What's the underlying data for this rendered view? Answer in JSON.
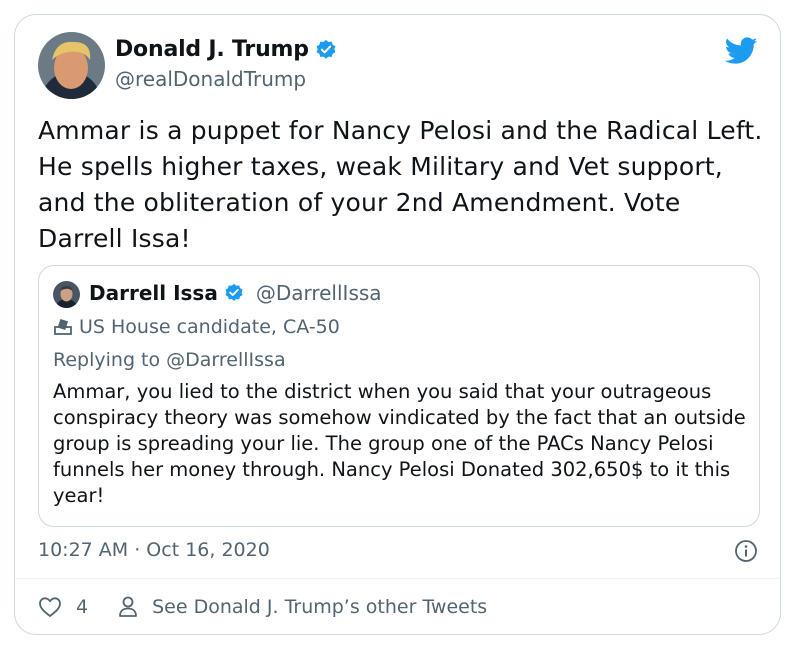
{
  "author": {
    "name": "Donald J. Trump",
    "handle": "@realDonaldTrump",
    "verified": true
  },
  "tweet": {
    "text": "Ammar is a puppet for Nancy Pelosi and the Radical Left. He spells higher taxes, weak Military and Vet support, and the obliteration of your 2nd Amendment. Vote Darrell Issa!",
    "timestamp": "10:27 AM · Oct 16, 2020",
    "likes": "4",
    "see_more": "See Donald J. Trump’s other Tweets"
  },
  "quoted": {
    "name": "Darrell Issa",
    "handle": "@DarrellIssa",
    "label": "US House candidate, CA-50",
    "replying_to": "Replying to @DarrellIssa",
    "text": "Ammar, you lied to the district when you said that your outrageous conspiracy theory was somehow vindicated by the fact that an outside group is spreading your lie. The group  one of the PACs Nancy Pelosi funnels her money through. Nancy Pelosi Donated 302,650$ to it this year!"
  },
  "icons": {
    "brand": "twitter-bird-icon",
    "verified": "verified-badge-icon",
    "label": "ballot-box-icon",
    "info": "info-icon",
    "like": "heart-icon",
    "profile": "person-icon"
  },
  "colors": {
    "twitter_blue": "#1d9bf0",
    "secondary_text": "#536471",
    "border": "#cfd9de"
  }
}
